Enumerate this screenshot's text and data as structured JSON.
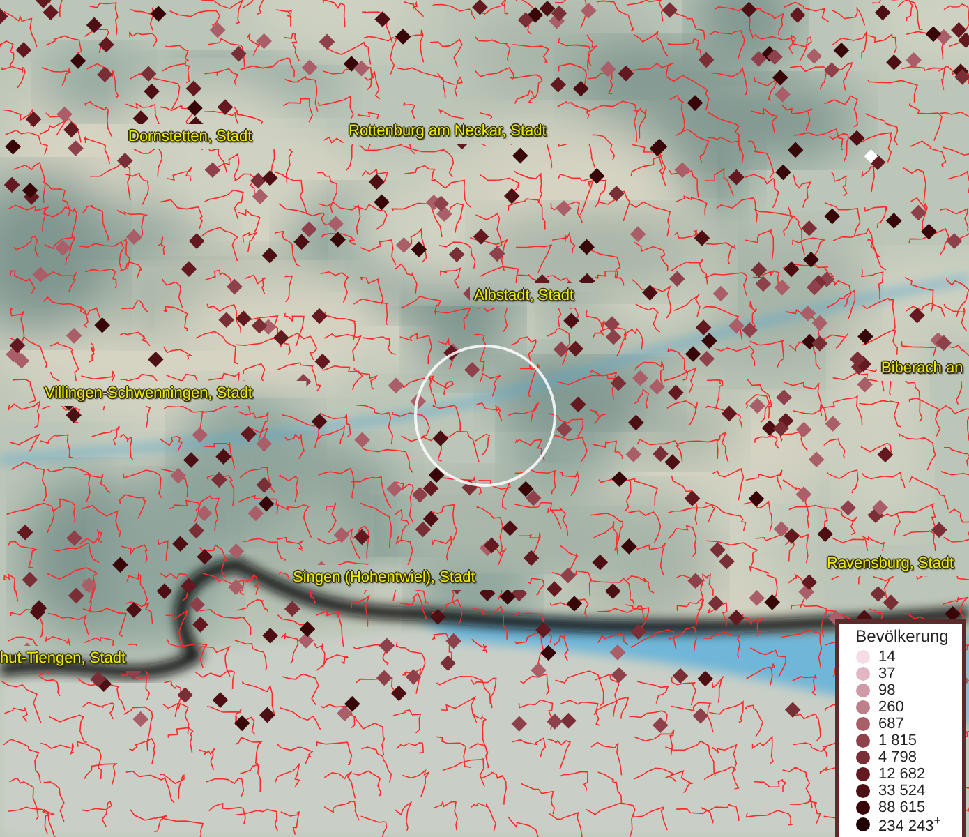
{
  "map": {
    "places": [
      {
        "name": "Dornstetten, Stadt"
      },
      {
        "name": "Rottenburg am Neckar, Stadt"
      },
      {
        "name": "Albstadt, Stadt"
      },
      {
        "name": "Biberach an"
      },
      {
        "name": "Villingen-Schwenningen, Stadt"
      },
      {
        "name": "Ravensburg, Stadt"
      },
      {
        "name": "Singen (Hohentwiel), Stadt"
      },
      {
        "name": "hut-Tiengen, Stadt"
      }
    ]
  },
  "legend": {
    "title": "Bevölkerung",
    "classes": [
      {
        "label": "14",
        "color": "#f5dce6"
      },
      {
        "label": "37",
        "color": "#e2b6c2"
      },
      {
        "label": "98",
        "color": "#d09ba7"
      },
      {
        "label": "260",
        "color": "#bf7f8a"
      },
      {
        "label": "687",
        "color": "#a95e68"
      },
      {
        "label": "1 815",
        "color": "#8f414b"
      },
      {
        "label": "4 798",
        "color": "#7a2e36"
      },
      {
        "label": "12 682",
        "color": "#63191f"
      },
      {
        "label": "33 524",
        "color": "#4e0f14"
      },
      {
        "label": "88 615",
        "color": "#380608"
      },
      {
        "label": "234 243$^{+}$",
        "color": "#200204"
      }
    ]
  }
}
